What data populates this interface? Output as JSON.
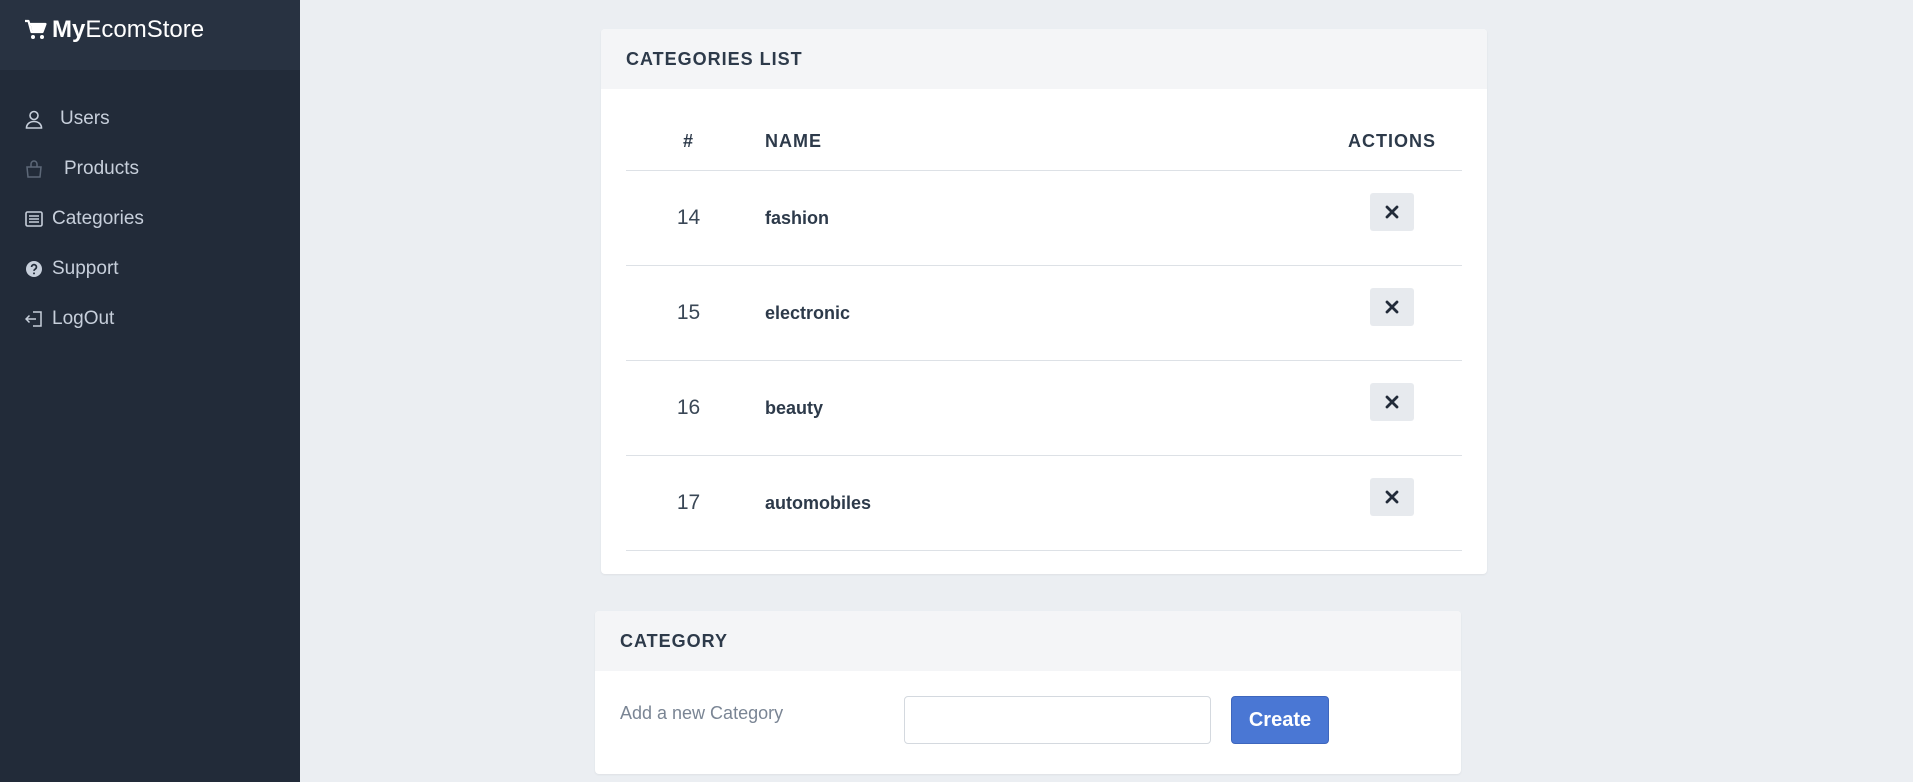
{
  "brand": {
    "bold": "My",
    "rest": "EcomStore",
    "icon": "cart-icon"
  },
  "sidebar": {
    "items": [
      {
        "label": "Users",
        "icon": "user-icon"
      },
      {
        "label": "Products",
        "icon": "bag-icon"
      },
      {
        "label": "Categories",
        "icon": "list-icon"
      },
      {
        "label": "Support",
        "icon": "question-circle-icon"
      },
      {
        "label": "LogOut",
        "icon": "logout-icon"
      }
    ]
  },
  "categories_list": {
    "title": "CATEGORIES LIST",
    "headers": {
      "num": "#",
      "name": "NAME",
      "actions": "ACTIONS"
    },
    "rows": [
      {
        "id": "14",
        "name": "fashion",
        "action_icon": "close-icon"
      },
      {
        "id": "15",
        "name": "electronic",
        "action_icon": "close-icon"
      },
      {
        "id": "16",
        "name": "beauty",
        "action_icon": "close-icon"
      },
      {
        "id": "17",
        "name": "automobiles",
        "action_icon": "close-icon"
      }
    ]
  },
  "category_form": {
    "title": "CATEGORY",
    "label": "Add a new Category",
    "input_value": "",
    "input_placeholder": "",
    "button_label": "Create"
  },
  "colors": {
    "sidebar_bg": "#222b39",
    "page_bg": "#ebeef2",
    "accent": "#4a77d4"
  }
}
